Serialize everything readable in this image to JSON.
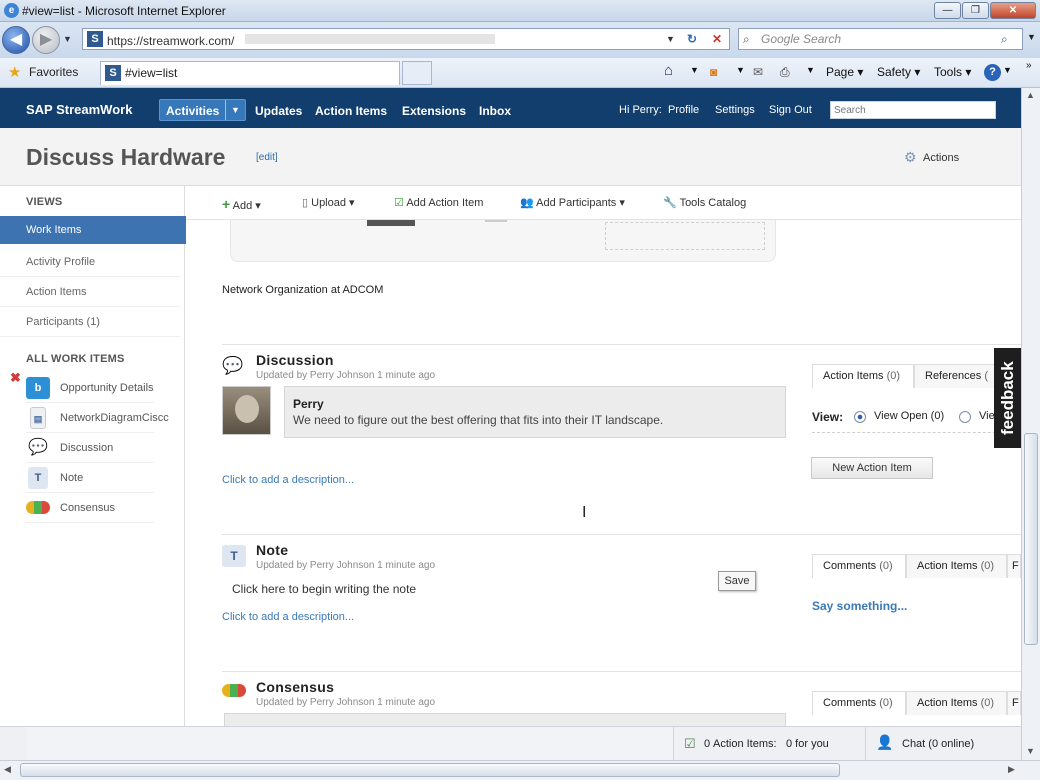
{
  "browser": {
    "window_title": "#view=list - Microsoft Internet Explorer",
    "url": "https://streamwork.com/",
    "search_placeholder": "Google Search",
    "favorites_label": "Favorites",
    "tab_title": "#view=list",
    "tab_icon": "S",
    "commands": [
      "Page",
      "Safety",
      "Tools"
    ]
  },
  "app": {
    "logo": "SAP StreamWork",
    "nav": [
      "Activities",
      "Updates",
      "Action Items",
      "Extensions",
      "Inbox"
    ],
    "greeting": "Hi Perry:",
    "right_links": [
      "Profile",
      "Settings",
      "Sign Out"
    ],
    "search_placeholder": "Search",
    "accent": "#123e6d"
  },
  "header": {
    "title": "Discuss Hardware",
    "edit": "[edit]",
    "actions": "Actions"
  },
  "sidebar": {
    "views_heading": "VIEWS",
    "views": [
      "Work Items",
      "Activity Profile",
      "Action Items",
      "Participants (1)"
    ],
    "all_heading": "ALL WORK ITEMS",
    "items": [
      {
        "label": "Opportunity Details",
        "icon": "b"
      },
      {
        "label": "NetworkDiagramCiscc",
        "icon": "doc"
      },
      {
        "label": "Discussion",
        "icon": "chat"
      },
      {
        "label": "Note",
        "icon": "T"
      },
      {
        "label": "Consensus",
        "icon": "consensus"
      }
    ]
  },
  "toolbar": {
    "add": "Add",
    "upload": "Upload",
    "add_action_item": "Add Action Item",
    "add_participants": "Add Participants",
    "tools_catalog": "Tools Catalog"
  },
  "content": {
    "image_caption": "Network Organization at ADCOM",
    "discussion": {
      "title": "Discussion",
      "updated": "Updated by Perry Johnson 1 minute ago",
      "author": "Perry",
      "message": "We need to figure out the best offering that fits into their IT landscape.",
      "add_description": "Click to add a description...",
      "tabs": [
        "Action Items",
        "(0)",
        "References",
        "("
      ],
      "view_label": "View:",
      "view_open": "View Open (0)",
      "view_other": "Vie",
      "new_action_item": "New Action Item"
    },
    "note": {
      "title": "Note",
      "updated": "Updated by Perry Johnson 1 minute ago",
      "placeholder": "Click here to begin writing the note",
      "add_description": "Click to add a description...",
      "save": "Save",
      "tabs": [
        "Comments",
        "(0)",
        "Action Items",
        "(0)",
        "F"
      ],
      "say_something": "Say something..."
    },
    "consensus": {
      "title": "Consensus",
      "updated": "Updated by Perry Johnson 1 minute ago",
      "tabs": [
        "Comments",
        "(0)",
        "Action Items",
        "(0)",
        "F"
      ]
    }
  },
  "statusbar": {
    "action_items_count": "0",
    "action_items_label": "Action Items:",
    "for_you": "0 for you",
    "chat": "Chat (0 online)"
  },
  "feedback": "feedback"
}
